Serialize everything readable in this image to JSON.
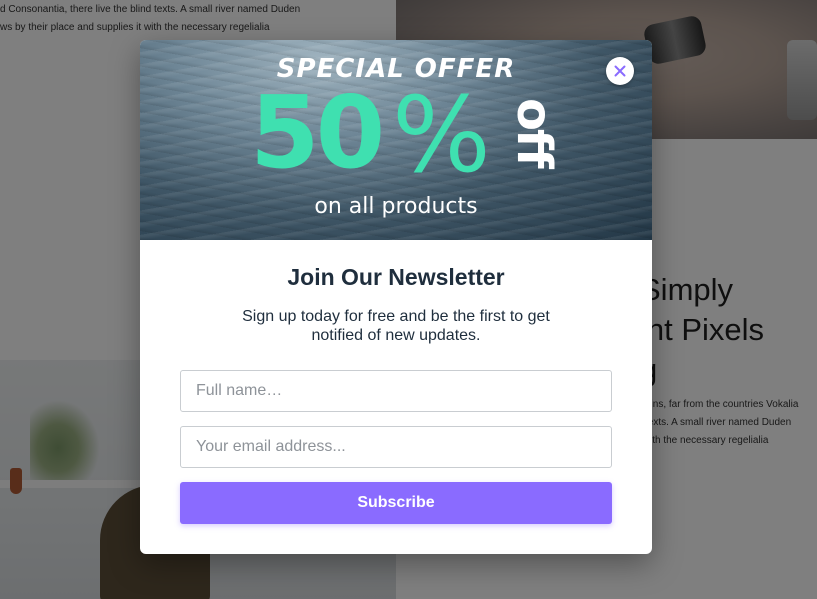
{
  "background": {
    "top_text_lines": [
      "d Consonantia, there live the blind texts. A small river named Duden",
      "ws by their place and supplies it with the necessary regelialia"
    ],
    "heading_lines": [
      "Simply",
      "int Pixels",
      "g"
    ],
    "para_lines": [
      "ains, far from the countries Vokalia",
      "texts. A small river named Duden",
      "vith the necessary regelialia"
    ]
  },
  "popup": {
    "banner": {
      "headline": "SPECIAL OFFER",
      "amount": "50",
      "percent_sign": "%",
      "off": "off",
      "subline": "on all products",
      "colors": {
        "amount": "#3fe0b0",
        "text": "#ffffff"
      }
    },
    "close_icon": "close-icon",
    "title": "Join Our Newsletter",
    "description": "Sign up today for free and be the first to get notified of new updates.",
    "name_placeholder": "Full name…",
    "email_placeholder": "Your email address...",
    "subscribe_label": "Subscribe",
    "colors": {
      "accent": "#8a6bff",
      "title": "#1f2e3d"
    }
  }
}
